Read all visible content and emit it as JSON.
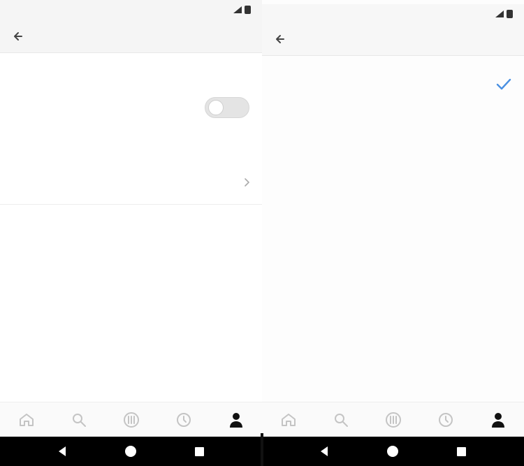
{
  "screens": [
    {
      "status_bar": {
        "time": ""
      },
      "app_bar": {
        "back_icon": "arrow-back-icon",
        "title": ""
      },
      "section_header": "",
      "toggle_row": {
        "label": "",
        "state": "off"
      },
      "helper_text": "",
      "value_row": {
        "label": "",
        "value": ""
      },
      "bottom_nav": {
        "items": [
          {
            "icon": "home-icon"
          },
          {
            "icon": "search-icon"
          },
          {
            "icon": "library-icon"
          },
          {
            "icon": "activity-icon"
          },
          {
            "icon": "profile-icon",
            "active": true
          }
        ]
      }
    },
    {
      "status_bar": {
        "time": ""
      },
      "app_bar": {
        "back_icon": "arrow-back-icon",
        "title": ""
      },
      "options": [
        {
          "label": "",
          "selected": true
        },
        {
          "label": "",
          "selected": false
        },
        {
          "label": "",
          "selected": false
        }
      ],
      "bottom_nav": {
        "items": [
          {
            "icon": "home-icon"
          },
          {
            "icon": "search-icon"
          },
          {
            "icon": "library-icon"
          },
          {
            "icon": "activity-icon"
          },
          {
            "icon": "profile-icon",
            "active": true
          }
        ]
      }
    }
  ],
  "colors": {
    "accent": "#4a90e2",
    "inactive_icon": "#c4c4c4",
    "active_icon": "#111111",
    "system_nav_bg": "#000000"
  },
  "system_nav": {
    "icons": [
      "back-icon",
      "home-icon",
      "recent-apps-icon"
    ]
  }
}
